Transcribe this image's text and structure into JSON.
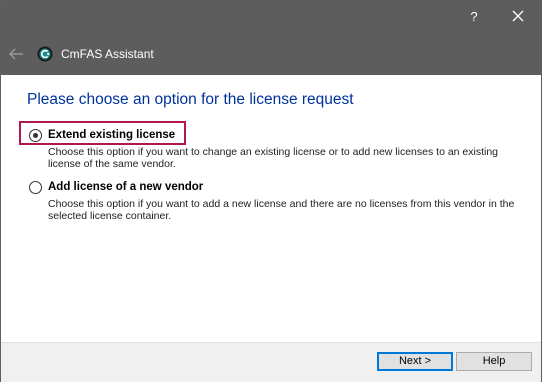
{
  "window": {
    "title": "CmFAS Assistant",
    "help_glyph": "?",
    "icons": {
      "back": "back-arrow-icon",
      "help": "help-icon",
      "close": "close-icon",
      "app": "cmfas-logo-icon"
    }
  },
  "main": {
    "heading": "Please choose an option for the license request",
    "options": [
      {
        "label": "Extend existing license",
        "description": "Choose this option if you want to change an existing license or to add new licenses to an existing license of the same vendor.",
        "selected": true
      },
      {
        "label": "Add license of a new vendor",
        "description": "Choose this option if you want to add a new license and there are no licenses from this vendor in the selected license container.",
        "selected": false
      }
    ]
  },
  "footer": {
    "next_label": "Next >",
    "help_label": "Help"
  },
  "colors": {
    "titlebar": "#5d5d5d",
    "heading": "#003399",
    "focus_frame": "#b2164f",
    "default_button_border": "#0078d7"
  }
}
